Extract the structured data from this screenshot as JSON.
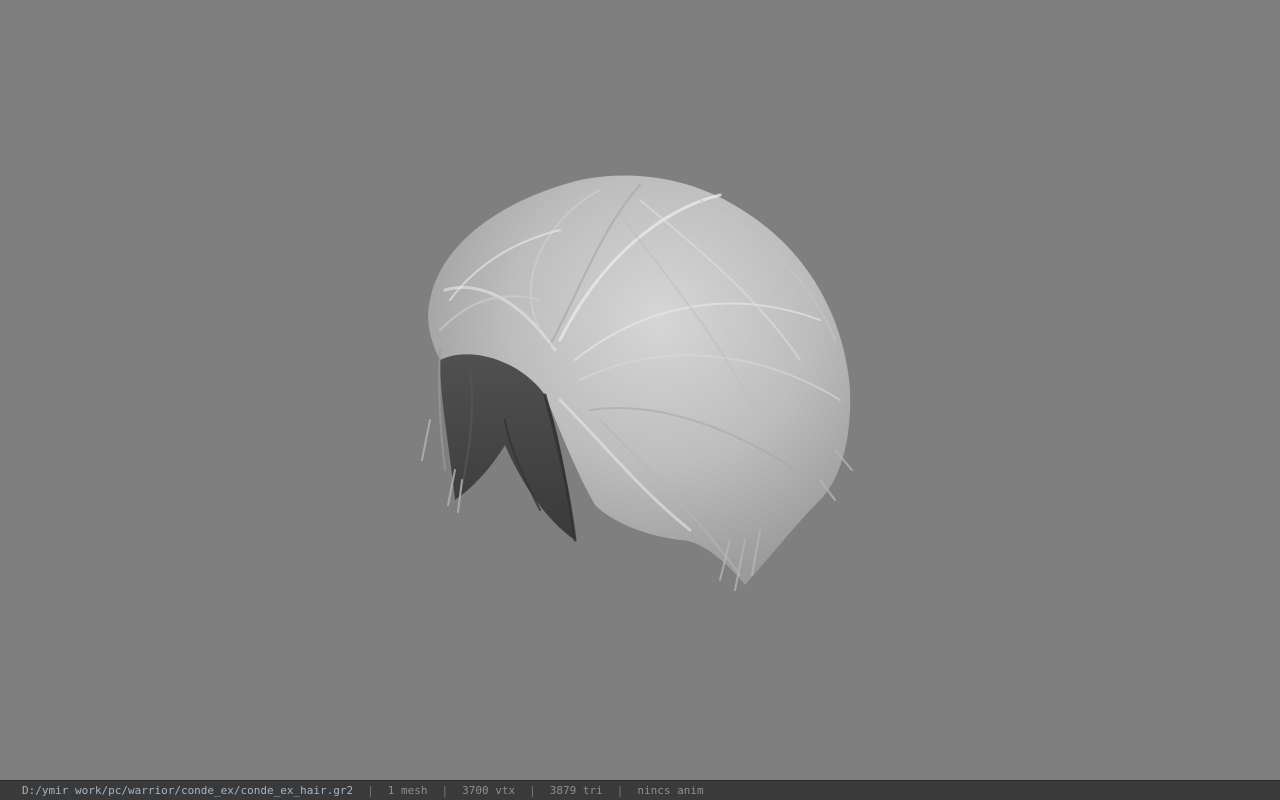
{
  "viewport": {
    "background_color": "#7f7f7f",
    "model_name": "hair mesh"
  },
  "status_bar": {
    "file_path": "D:/ymir work/pc/warrior/conde_ex/conde_ex_hair.gr2",
    "mesh_count": "1 mesh",
    "vertex_count": "3700 vtx",
    "triangle_count": "3879 tri",
    "anim_status": "nincs anim",
    "separator": "|"
  }
}
